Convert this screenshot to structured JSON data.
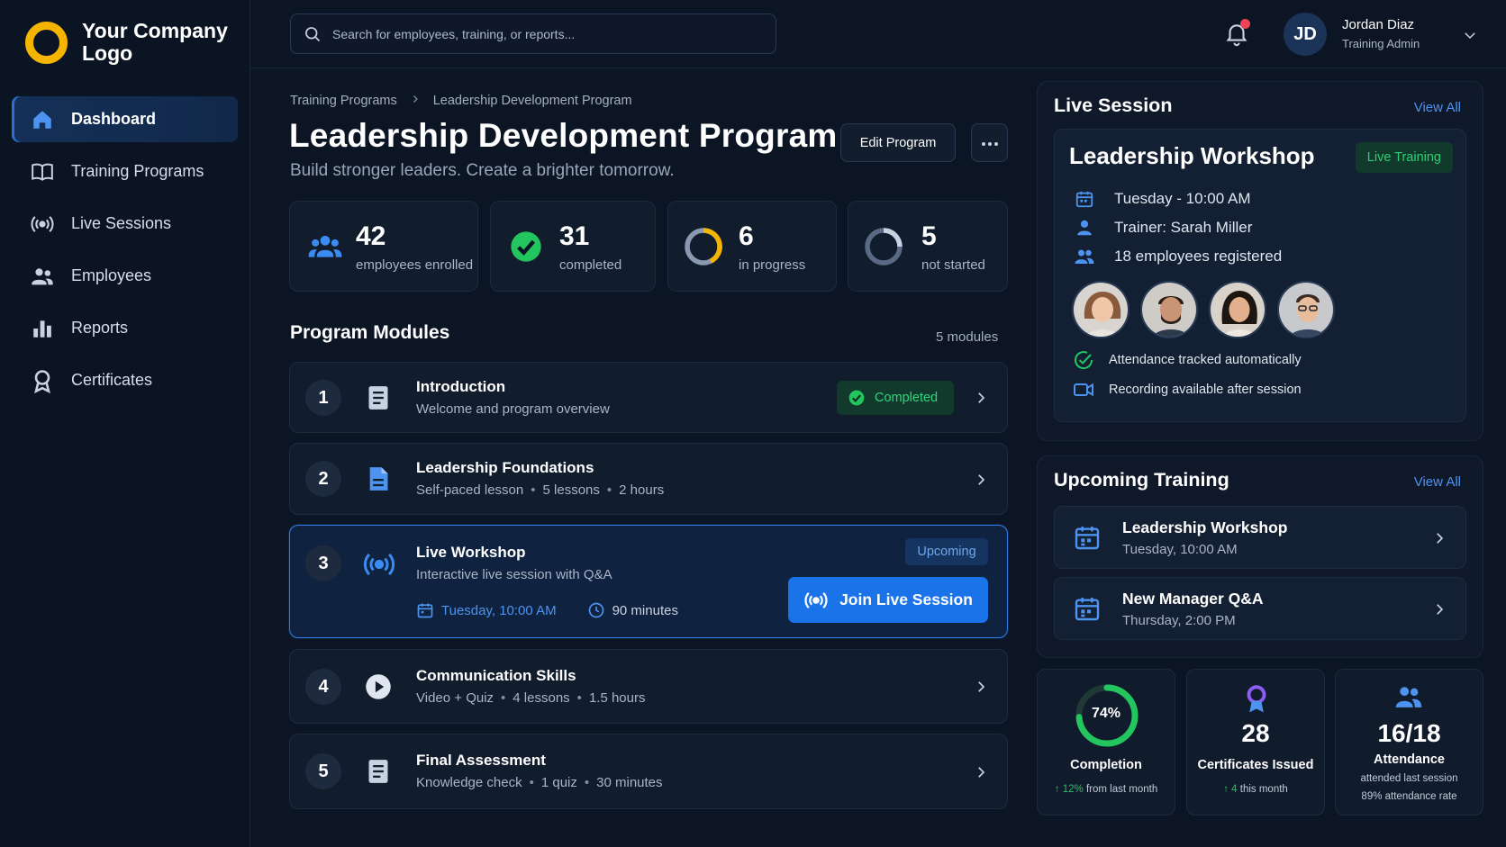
{
  "brand": {
    "logo_text": "Your Company Logo",
    "accent": "#f5b400"
  },
  "sidebar": {
    "items": [
      {
        "label": "Dashboard",
        "icon": "home-icon",
        "active": true
      },
      {
        "label": "Training Programs",
        "icon": "book-icon"
      },
      {
        "label": "Live Sessions",
        "icon": "broadcast-icon"
      },
      {
        "label": "Employees",
        "icon": "users-icon"
      },
      {
        "label": "Reports",
        "icon": "bar-chart-icon"
      },
      {
        "label": "Certificates",
        "icon": "award-icon"
      }
    ]
  },
  "topbar": {
    "search_placeholder": "Search for employees, training, or reports...",
    "notifications": {
      "has_unread": true,
      "dot_color": "#ef4453"
    },
    "user": {
      "initials": "JD",
      "name": "Jordan Diaz",
      "role": "Training Admin"
    }
  },
  "page": {
    "breadcrumb": [
      "Training Programs",
      "Leadership Development Program"
    ],
    "title": "Leadership Development Program",
    "subtitle": "Build stronger leaders. Create a brighter tomorrow.",
    "edit_label": "Edit Program",
    "more_label": "..."
  },
  "stats": [
    {
      "value": "42",
      "label": "employees enrolled",
      "icon": "users-icon"
    },
    {
      "value": "31",
      "label": "completed",
      "icon": "check-circle-icon"
    },
    {
      "value": "6",
      "label": "in progress",
      "icon": "progress-ring-icon"
    },
    {
      "value": "5",
      "label": "not started",
      "icon": "empty-ring-icon"
    }
  ],
  "modules": {
    "title": "Program Modules",
    "count_label": "5 modules",
    "items": [
      {
        "num": "1",
        "title": "Introduction",
        "desc": [
          "Welcome and program overview"
        ],
        "icon": "document-icon",
        "status": "Completed"
      },
      {
        "num": "2",
        "title": "Leadership Foundations",
        "desc": [
          "Self-paced lesson",
          "5 lessons",
          "2 hours"
        ],
        "icon": "file-text-icon"
      },
      {
        "num": "3",
        "title": "Live Workshop",
        "desc": [
          "Interactive live session with Q&A"
        ],
        "icon": "broadcast-icon",
        "status": "Upcoming",
        "date": "Tuesday, 10:00 AM",
        "duration": "90 minutes",
        "action": "Join Live Session"
      },
      {
        "num": "4",
        "title": "Communication Skills",
        "desc": [
          "Video + Quiz",
          "4 lessons",
          "1.5 hours"
        ],
        "icon": "play-icon"
      },
      {
        "num": "5",
        "title": "Final Assessment",
        "desc": [
          "Knowledge check",
          "1 quiz",
          "30 minutes"
        ],
        "icon": "document-icon"
      }
    ]
  },
  "live_session": {
    "title": "Live Session",
    "view_all": "View All",
    "card": {
      "title": "Leadership Workshop",
      "badge": "Live Training",
      "when": "Tuesday - 10:00 AM",
      "trainer": "Trainer: Sarah Miller",
      "registered": "18 employees registered",
      "attendance_note": "Attendance tracked automatically",
      "recording_note": "Recording available after session"
    }
  },
  "upcoming": {
    "title": "Upcoming Training",
    "view_all": "View All",
    "items": [
      {
        "title": "Leadership Workshop",
        "when": "Tuesday, 10:00 AM"
      },
      {
        "title": "New Manager Q&A",
        "when": "Thursday, 2:00 PM"
      }
    ]
  },
  "summary": {
    "completion": {
      "percent_text": "74%",
      "percent": 74,
      "label": "Completion",
      "foot_value": "12%",
      "foot_text": "from last month"
    },
    "certificates": {
      "value": "28",
      "label": "Certificates Issued",
      "foot_value": "4",
      "foot_text": "this month"
    },
    "attendance": {
      "value": "16/18",
      "label": "Attendance",
      "foot1": "attended last session",
      "foot2": "89% attendance rate"
    }
  }
}
